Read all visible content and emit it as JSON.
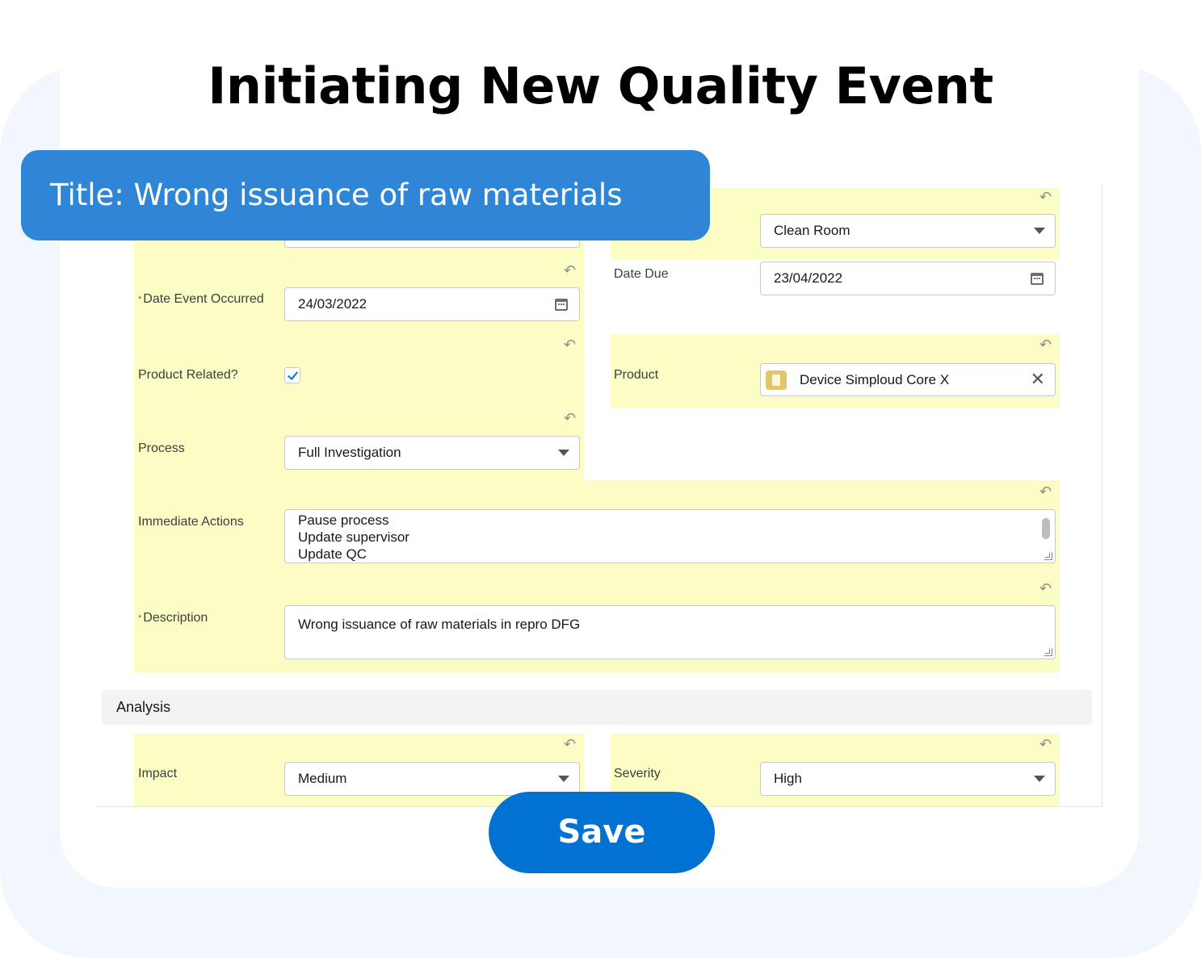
{
  "page": {
    "heading": "Initiating New Quality Event",
    "title_banner": "Title: Wrong issuance of raw materials",
    "save_label": "Save"
  },
  "form": {
    "location": {
      "value": "Clean Room"
    },
    "date_event_occurred": {
      "required_mark": "*",
      "label": "Date Event Occurred",
      "value": "24/03/2022"
    },
    "date_due": {
      "label": "Date Due",
      "value": "23/04/2022"
    },
    "product_related": {
      "label": "Product Related?",
      "checked": true
    },
    "product": {
      "label": "Product",
      "value": "Device Simploud Core X"
    },
    "process": {
      "label": "Process",
      "value": "Full Investigation"
    },
    "immediate_actions": {
      "label": "Immediate Actions",
      "lines": [
        "Pause process",
        "Update supervisor",
        "Update QC"
      ]
    },
    "description": {
      "required_mark": "*",
      "label": "Description",
      "value": "Wrong issuance of raw materials in repro DFG"
    }
  },
  "analysis": {
    "section_title": "Analysis",
    "impact": {
      "label": "Impact",
      "value": "Medium"
    },
    "severity": {
      "label": "Severity",
      "value": "High"
    }
  },
  "icons": {
    "undo": "undo-icon",
    "calendar": "calendar-icon",
    "dropdown": "chevron-down-icon",
    "clear": "close-icon",
    "product": "product-icon"
  },
  "colors": {
    "highlight": "#fbfdc5",
    "banner": "#2f86d6",
    "save_button": "#0171d2",
    "background": "#f2f7fe"
  }
}
